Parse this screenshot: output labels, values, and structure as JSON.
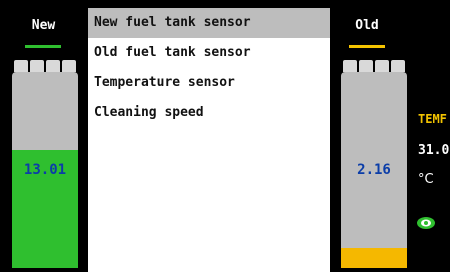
{
  "left_tank": {
    "label": "New",
    "value": "13.01",
    "fill_fraction": 0.6,
    "fill_color": "#2fbf2f",
    "indicator_color": "#2fbf2f"
  },
  "right_tank": {
    "label": "Old",
    "value": "2.16",
    "fill_fraction": 0.1,
    "fill_color": "#f5b800",
    "indicator_color": "#f5c400"
  },
  "menu": {
    "selected_index": 0,
    "items": [
      {
        "label": "New fuel tank sensor"
      },
      {
        "label": "Old fuel tank sensor"
      },
      {
        "label": "Temperature sensor"
      },
      {
        "label": "Cleaning speed"
      }
    ]
  },
  "temperature": {
    "label": "TEMF",
    "value": "31.0",
    "unit": "°C",
    "status_icon": "eye-icon",
    "status_color": "#2fbf2f"
  }
}
